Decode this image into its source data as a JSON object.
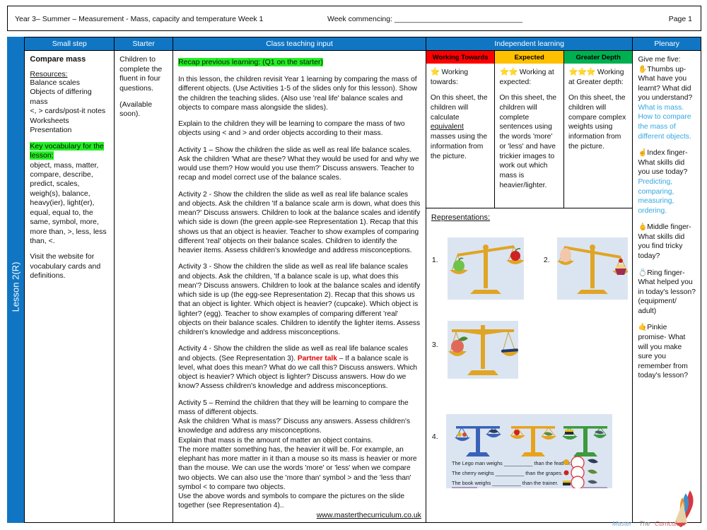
{
  "header": {
    "title": "Year 3– Summer – Measurement - Mass, capacity and temperature  Week 1",
    "week_commencing": "Week commencing: _______________________________",
    "page": "Page 1"
  },
  "columns": {
    "small_step": "Small step",
    "starter": "Starter",
    "class_teaching_input": "Class teaching input",
    "independent_learning": "Independent learning",
    "plenary": "Plenary"
  },
  "lesson_tab": "Lesson 2(R)",
  "small_step": {
    "title": "Compare mass",
    "resources_label": "Resources:",
    "resources": "Balance scales\nObjects of differing mass\n<, > cards/post-it notes\nWorksheets\nPresentation",
    "vocab_label": "Key vocabulary for the lesson:",
    "vocab": "object, mass, matter, compare, describe, predict, scales, weigh(s), balance, heavy(ier), light(er), equal, equal to, the same, symbol, more, more than, >, less, less than, <.",
    "website_note": "Visit the website for vocabulary cards and definitions."
  },
  "starter": {
    "text": "Children to complete the fluent in four questions.",
    "availability": "(Available soon)."
  },
  "teaching": {
    "recap_heading": "Recap previous learning: (Q1 on the starter)",
    "paragraphs": [
      "In this lesson, the children revisit Year 1 learning by comparing the mass of different objects. (Use Activities 1-5 of the slides only for this lesson). Show the children the teaching slides. (Also use 'real life' balance scales and objects to compare mass alongside the slides).",
      "Explain to the children they will be learning to compare the mass of two objects using < and > and order objects according to their mass.",
      "Activity 1 – Show the children the slide as well as real life balance scales. Ask the children 'What are these? What they would be used for and why we would use them? How would you use them?' Discuss answers. Teacher to recap and model correct use of the balance scales.",
      "Activity 2 - Show the children the slide as well as real life balance scales and objects. Ask the children 'If a balance scale arm is down, what does this mean?' Discuss answers. Children to look at the balance scales and identify which side is down (the green apple-see Representation 1). Recap that this shows us that an object is heavier. Teacher to show examples of comparing different 'real' objects on their balance scales. Children to identify the heavier items. Assess children's knowledge and address misconceptions.",
      "Activity 3 - Show the children the slide as well as real life balance scales and objects. Ask the children, 'If a balance scale is up, what does this mean'? Discuss answers. Children to look at the balance scales and identify which side is up (the egg-see Representation 2). Recap that this shows us that an object is lighter. Which object is heavier? (cupcake). Which object is lighter? (egg). Teacher to show examples of comparing different 'real' objects on their balance scales. Children to identify the lighter items. Assess children's knowledge and address misconceptions."
    ],
    "activity4_pre": "Activity 4 - Show the children the slide as well as real life balance scales and objects. (See Representation 3). ",
    "activity4_partner": "Partner talk",
    "activity4_post": " – If a balance scale is level, what does this mean? What do we call this? Discuss answers. Which object is heavier? Which object is lighter? Discuss answers. How do we know? Assess children's knowledge and address misconceptions.",
    "activity5": "Activity 5 – Remind the children that they will be learning to compare the mass of different objects.\nAsk the children 'What is mass?' Discuss any answers. Assess children's knowledge and address any misconceptions.\nExplain that mass is the amount of matter an object contains.\nThe more matter something has, the heavier it will be. For example, an elephant has more matter in it than a mouse so its mass is heavier or more than the mouse. We can use the words 'more' or 'less' when we compare two objects. We can also use the 'more than' symbol > and the 'less than' symbol < to compare two objects.\nUse the above words and symbols to compare the pictures on the slide together (see Representation 4)..",
    "url": "www.masterthecurriculum.co.uk"
  },
  "independent": {
    "bands": [
      {
        "label": "Working Towards",
        "color": "#ff0000"
      },
      {
        "label": "Expected",
        "color": "#ffc000"
      },
      {
        "label": "Greater Depth",
        "color": "#00b050"
      }
    ],
    "working_towards": {
      "stars": "⭐",
      "heading": "Working towards:",
      "body_pre": "On this sheet, the children will calculate ",
      "body_underline": "equivalent",
      "body_post": " masses using the information from the picture."
    },
    "expected": {
      "stars": "⭐⭐",
      "heading": "Working at expected:",
      "body": "On this sheet, the children will complete sentences using the words 'more' or 'less' and have trickier images to work out which mass is heavier/lighter."
    },
    "greater_depth": {
      "stars": "⭐⭐⭐",
      "heading": "Working at Greater depth:",
      "body": "On this sheet, the children will compare complex weights using information from the picture."
    },
    "representations_label": "Representations:",
    "representations": [
      {
        "num": "1.",
        "caption": "balance tipped left - green apple down, red apple up"
      },
      {
        "num": "2.",
        "caption": "balance tipped right - egg up, cupcake down"
      },
      {
        "num": "3.",
        "caption": "balance level - apple and pen"
      },
      {
        "num": "4.",
        "caption": "three balance scales with sentence stems"
      }
    ],
    "rep4_sentences": [
      "The Lego man weighs __________ than the feather.",
      "The cherry weighs __________ than the grapes.",
      "The book weighs __________ than the trainer."
    ]
  },
  "plenary": {
    "intro": "Give me five:",
    "items": [
      {
        "hand": "✋",
        "question": "Thumbs up- What have you learnt? What did you understand?",
        "answer": "What is mass. How to compare the mass of different objects."
      },
      {
        "hand": "☝",
        "question": "Index finger- What skills did you use today?",
        "answer": "Predicting, comparing, measuring, ordering."
      },
      {
        "hand": "🖕",
        "question": "Middle finger- What skills did you find tricky today?",
        "answer": ""
      },
      {
        "hand": "💍",
        "question": "Ring finger- What helped you in today's lesson? (equipment/ adult)",
        "answer": ""
      },
      {
        "hand": "🤙",
        "question": "Pinkie promise- What will you make sure you remember from today's lesson?",
        "answer": ""
      }
    ]
  },
  "logo": {
    "word1": "Master",
    "word2": "The",
    "word3": "Curriculum"
  },
  "colors": {
    "header_blue": "#1076c4",
    "highlight_green": "#22ef22",
    "partner_red": "#e00000",
    "answer_blue": "#31a7e0",
    "rep_bg": "#dbe5f1",
    "scale_gold": "#e0a526"
  }
}
